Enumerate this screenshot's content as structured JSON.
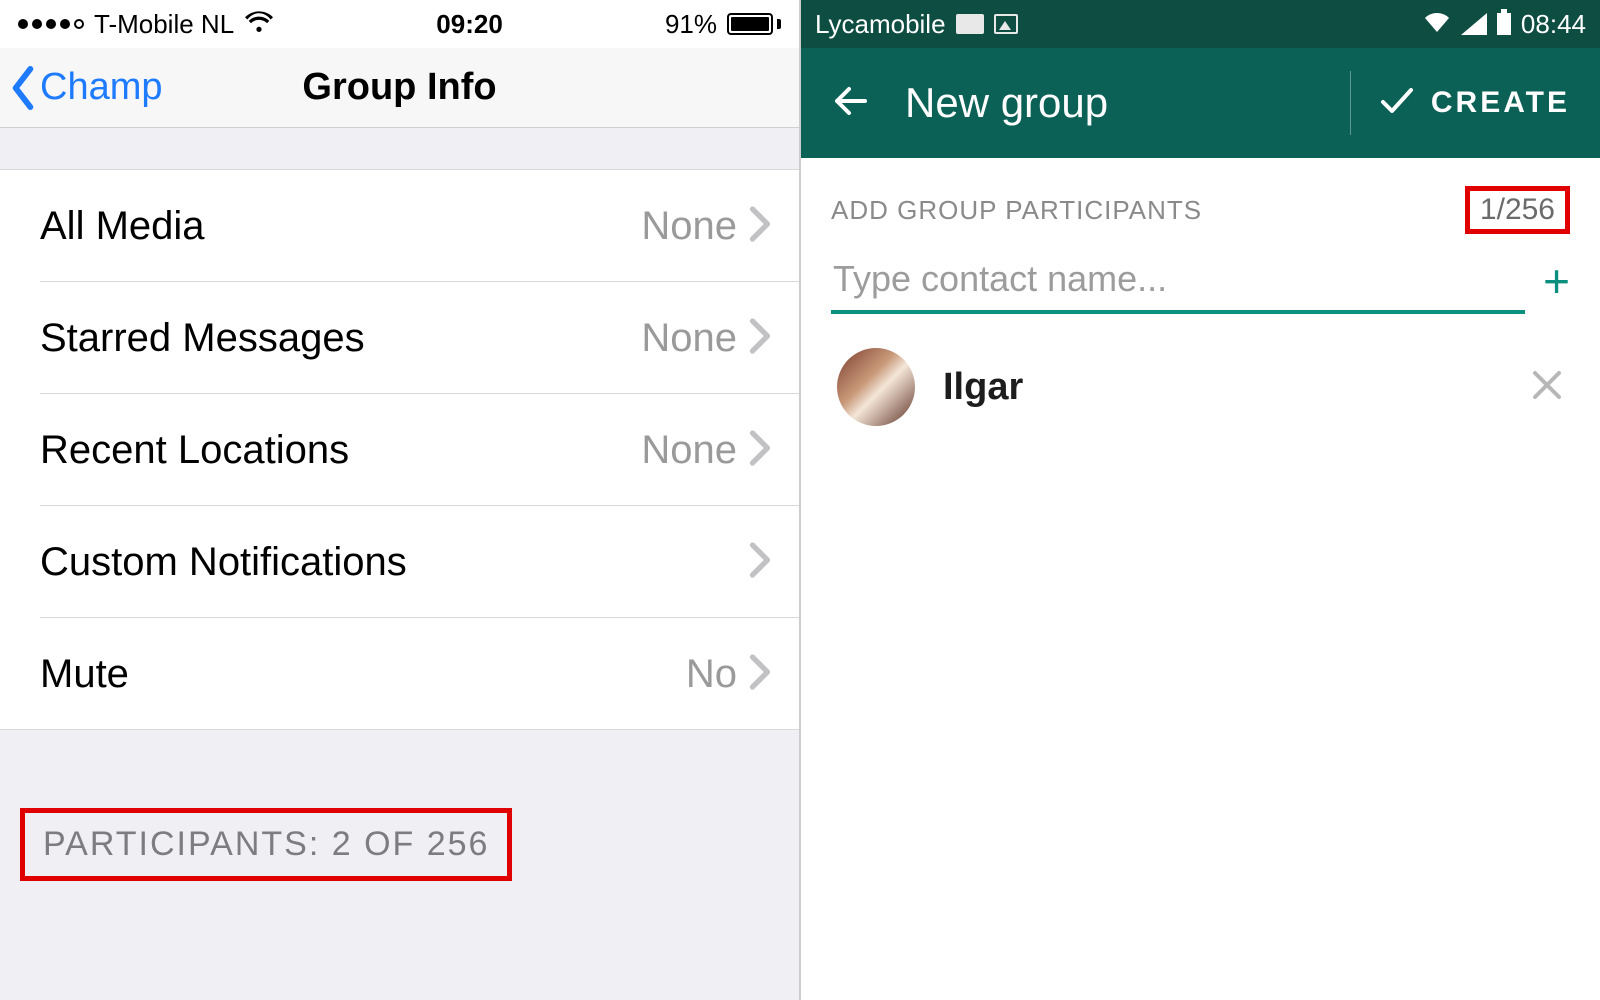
{
  "ios": {
    "status": {
      "carrier": "T-Mobile NL",
      "time": "09:20",
      "battery_pct": "91%"
    },
    "nav": {
      "back_label": "Champ",
      "title": "Group Info"
    },
    "rows": [
      {
        "label": "All Media",
        "value": "None"
      },
      {
        "label": "Starred Messages",
        "value": "None"
      },
      {
        "label": "Recent Locations",
        "value": "None"
      },
      {
        "label": "Custom Notifications",
        "value": ""
      },
      {
        "label": "Mute",
        "value": "No"
      }
    ],
    "participants_label": "PARTICIPANTS: 2 OF 256"
  },
  "android": {
    "status": {
      "carrier": "Lycamobile",
      "time": "08:44"
    },
    "appbar": {
      "title": "New group",
      "create_label": "CREATE"
    },
    "subheader": "ADD GROUP PARTICIPANTS",
    "count": "1/256",
    "input_placeholder": "Type contact name...",
    "contacts": [
      {
        "name": "Ilgar"
      }
    ]
  },
  "colors": {
    "android_primary": "#0b6156",
    "android_accent": "#0b8f7e",
    "ios_link": "#1e7bff",
    "highlight": "#e10000"
  }
}
